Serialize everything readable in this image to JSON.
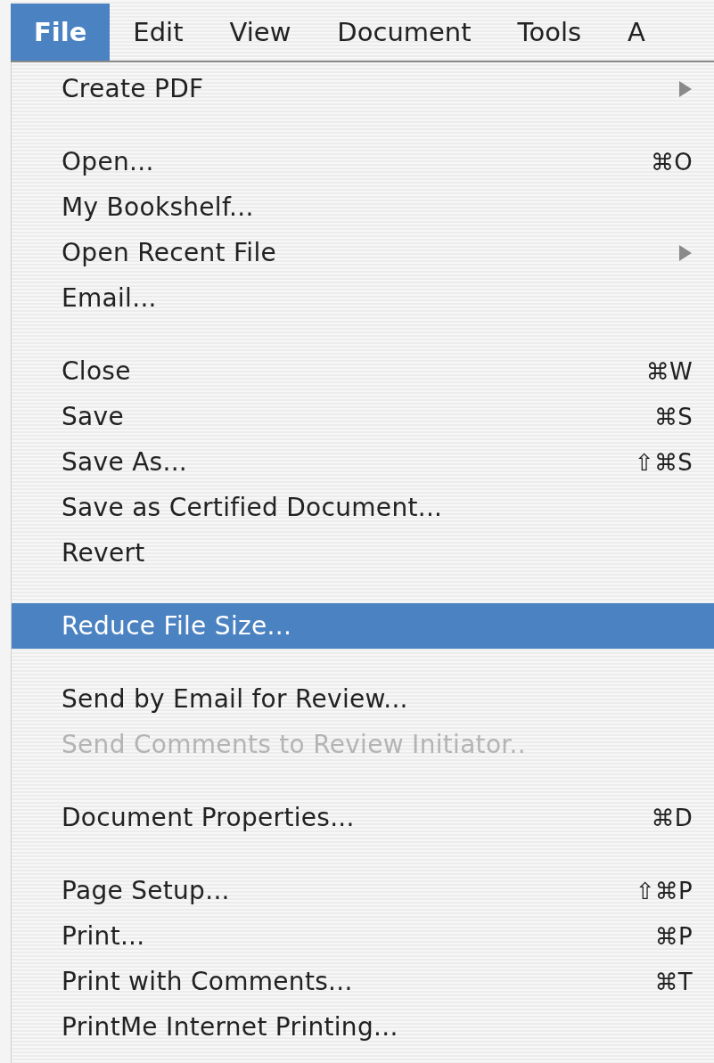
{
  "menubar": [
    {
      "label": "File",
      "selected": true
    },
    {
      "label": "Edit",
      "selected": false
    },
    {
      "label": "View",
      "selected": false
    },
    {
      "label": "Document",
      "selected": false
    },
    {
      "label": "Tools",
      "selected": false
    },
    {
      "label": "A",
      "selected": false
    }
  ],
  "menu": {
    "groups": [
      {
        "items": [
          {
            "label": "Create PDF",
            "kind": "submenu",
            "selected": false,
            "disabled": false
          }
        ]
      },
      {
        "items": [
          {
            "label": "Open...",
            "kind": "command",
            "shortcut": "⌘O",
            "selected": false,
            "disabled": false
          },
          {
            "label": "My Bookshelf...",
            "kind": "command",
            "selected": false,
            "disabled": false
          },
          {
            "label": "Open Recent File",
            "kind": "submenu",
            "selected": false,
            "disabled": false
          },
          {
            "label": "Email...",
            "kind": "command",
            "selected": false,
            "disabled": false
          }
        ]
      },
      {
        "items": [
          {
            "label": "Close",
            "kind": "command",
            "shortcut": "⌘W",
            "selected": false,
            "disabled": false
          },
          {
            "label": "Save",
            "kind": "command",
            "shortcut": "⌘S",
            "selected": false,
            "disabled": false
          },
          {
            "label": "Save As...",
            "kind": "command",
            "shortcut": "⇧⌘S",
            "selected": false,
            "disabled": false
          },
          {
            "label": "Save as Certified Document...",
            "kind": "command",
            "selected": false,
            "disabled": false
          },
          {
            "label": "Revert",
            "kind": "command",
            "selected": false,
            "disabled": false
          }
        ]
      },
      {
        "items": [
          {
            "label": "Reduce File Size...",
            "kind": "command",
            "selected": true,
            "disabled": false
          }
        ]
      },
      {
        "items": [
          {
            "label": "Send by Email for Review...",
            "kind": "command",
            "selected": false,
            "disabled": false
          },
          {
            "label": "Send Comments to Review Initiator..",
            "kind": "command",
            "selected": false,
            "disabled": true
          }
        ]
      },
      {
        "items": [
          {
            "label": "Document Properties...",
            "kind": "command",
            "shortcut": "⌘D",
            "selected": false,
            "disabled": false
          }
        ]
      },
      {
        "items": [
          {
            "label": "Page Setup...",
            "kind": "command",
            "shortcut": "⇧⌘P",
            "selected": false,
            "disabled": false
          },
          {
            "label": "Print...",
            "kind": "command",
            "shortcut": "⌘P",
            "selected": false,
            "disabled": false
          },
          {
            "label": "Print with Comments...",
            "kind": "command",
            "shortcut": "⌘T",
            "selected": false,
            "disabled": false
          },
          {
            "label": "PrintMe Internet Printing...",
            "kind": "command",
            "selected": false,
            "disabled": false
          }
        ]
      }
    ]
  }
}
